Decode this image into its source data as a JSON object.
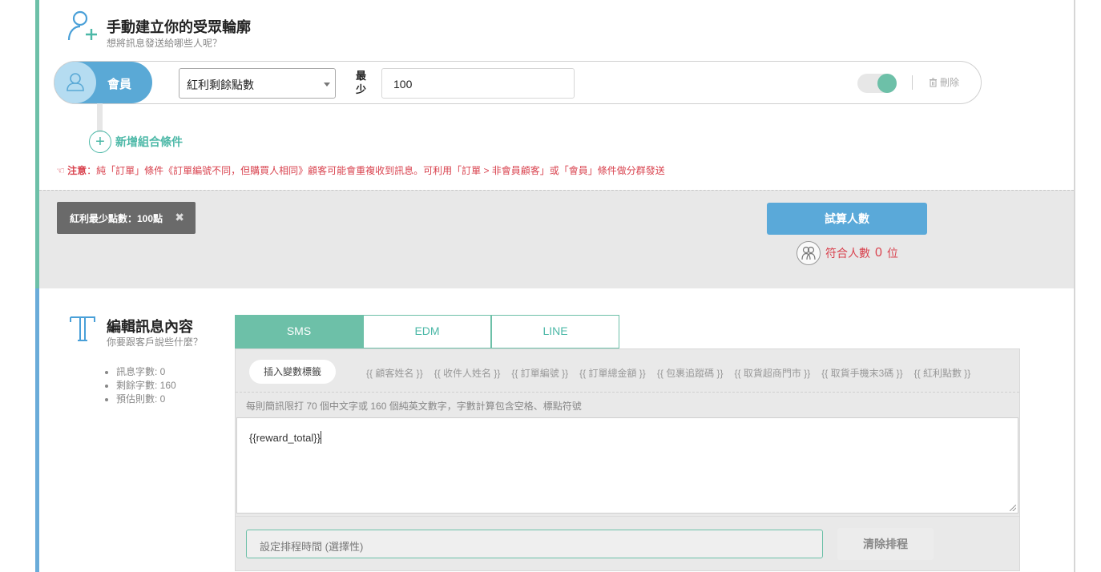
{
  "audience": {
    "title": "手動建立你的受眾輪廓",
    "subtitle": "想將訊息發送給哪些人呢？"
  },
  "condition": {
    "member_label": "會員",
    "field_selected": "紅利剩餘點數",
    "min_label": "最少",
    "min_value": "100",
    "toggle_on": true,
    "delete_label": "刪除"
  },
  "add_condition_label": "新增組合條件",
  "notice": {
    "prefix": "注意",
    "text": "：純「訂單」條件《訂單編號不同，但購買人相同》顧客可能會重複收到訊息。可利用「訂單 > 非會員顧客」或「會員」條件做分群發送"
  },
  "summary": {
    "tag_label": "紅利最少點數：100點",
    "tag_close": "✖",
    "calc_button": "試算人數",
    "match_label": "符合人數",
    "match_count": "0",
    "match_unit": "位"
  },
  "message": {
    "title": "編輯訊息內容",
    "subtitle": "你要跟客戶說些什麼？",
    "stats": [
      "訊息字數: 0",
      "剩餘字數: 160",
      "預估則數: 0"
    ],
    "tabs": [
      "SMS",
      "EDM",
      "LINE"
    ],
    "active_tab": "SMS",
    "insert_label": "插入變數標籤",
    "variables": [
      "{{ 顧客姓名 }}",
      "{{ 收件人姓名 }}",
      "{{ 訂單編號 }}",
      "{{ 訂單總金額 }}",
      "{{ 包裹追蹤碼 }}",
      "{{ 取貨超商門市 }}",
      "{{ 取貨手機末3碼 }}",
      "{{ 紅利點數 }}"
    ],
    "hint": "每則簡訊限打 70 個中文字或 160 個純英文數字，字數計算包含空格、標點符號",
    "content": "{{reward_total}}",
    "schedule_placeholder": "設定排程時間 (選擇性)",
    "clear_schedule": "清除排程"
  },
  "colors": {
    "green": "#6dc0a8",
    "blue": "#5aa9d9",
    "alert": "#d9434f"
  }
}
